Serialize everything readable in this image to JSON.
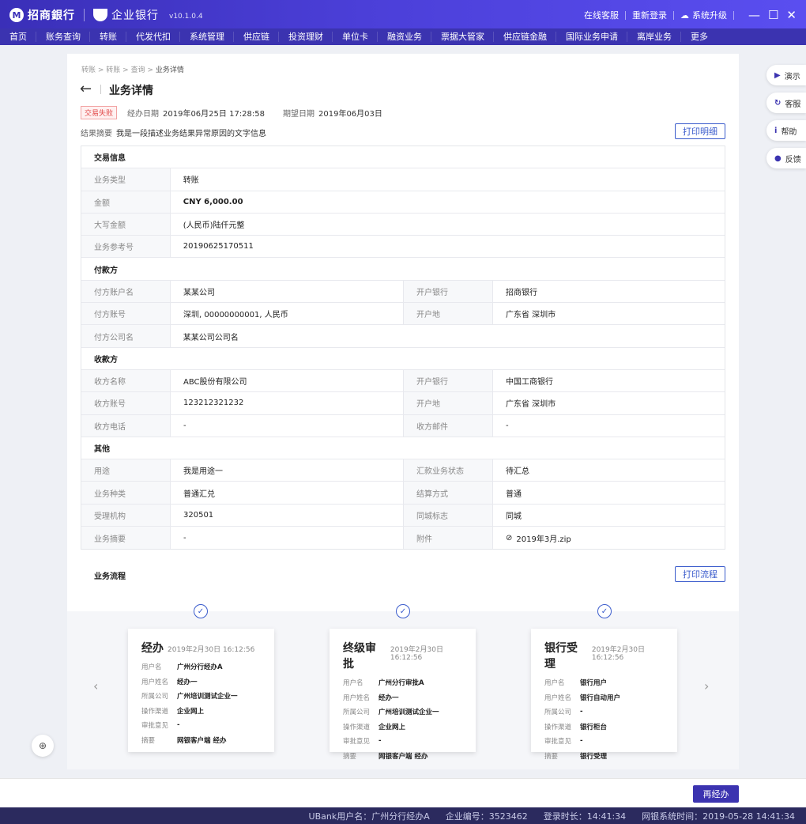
{
  "topbar": {
    "bank_name": "招商銀行",
    "ent_name": "企业银行",
    "version": "v10.1.0.4",
    "online_service": "在线客服",
    "relogin": "重新登录",
    "upgrade": "系统升级"
  },
  "nav": [
    "首页",
    "账务查询",
    "转账",
    "代发代扣",
    "系统管理",
    "供应链",
    "投资理财",
    "单位卡",
    "融资业务",
    "票据大管家",
    "供应链金融",
    "国际业务申请",
    "离岸业务",
    "更多"
  ],
  "breadcrumb": [
    "转账",
    "转账",
    "查询",
    "业务详情"
  ],
  "page_title": "业务详情",
  "status_badge": "交易失败",
  "meta": {
    "handle_label": "经办日期",
    "handle_value": "2019年06月25日 17:28:58",
    "expect_label": "期望日期",
    "expect_value": "2019年06月03日"
  },
  "summary": {
    "label": "结果摘要",
    "value": "我是一段描述业务结果异常原因的文字信息"
  },
  "print_detail": "打印明细",
  "print_flow": "打印流程",
  "sections": {
    "trade": {
      "title": "交易信息",
      "type_label": "业务类型",
      "type_value": "转账",
      "amount_label": "金额",
      "amount_value": "CNY 6,000.00",
      "upper_label": "大写金额",
      "upper_value": "(人民币)陆仟元整",
      "ref_label": "业务参考号",
      "ref_value": "20190625170511"
    },
    "payer": {
      "title": "付款方",
      "name_label": "付方账户名",
      "name_value": "某某公司",
      "bank_label": "开户银行",
      "bank_value": "招商银行",
      "acct_label": "付方账号",
      "acct_value": "深圳, 00000000001, 人民币",
      "loc_label": "开户地",
      "loc_value": "广东省 深圳市",
      "company_label": "付方公司名",
      "company_value": "某某公司公司名"
    },
    "payee": {
      "title": "收款方",
      "name_label": "收方名称",
      "name_value": "ABC股份有限公司",
      "bank_label": "开户银行",
      "bank_value": "中国工商银行",
      "acct_label": "收方账号",
      "acct_value": "123212321232",
      "loc_label": "开户地",
      "loc_value": "广东省 深圳市",
      "phone_label": "收方电话",
      "phone_value": "-",
      "mail_label": "收方邮件",
      "mail_value": "-"
    },
    "other": {
      "title": "其他",
      "use_label": "用途",
      "use_value": "我是用途一",
      "state_label": "汇款业务状态",
      "state_value": "待汇总",
      "kind_label": "业务种类",
      "kind_value": "普通汇兑",
      "settle_label": "结算方式",
      "settle_value": "普通",
      "org_label": "受理机构",
      "org_value": "320501",
      "city_label": "同城标志",
      "city_value": "同城",
      "abstract_label": "业务摘要",
      "abstract_value": "-",
      "attach_label": "附件",
      "attach_value": "2019年3月.zip"
    }
  },
  "flow_title": "业务流程",
  "flow_labels": {
    "user": "用户名",
    "username": "用户姓名",
    "company": "所属公司",
    "channel": "操作渠道",
    "opinion": "审批意见",
    "abstract": "摘要"
  },
  "flow_steps": [
    {
      "name": "经办",
      "time": "2019年2月30日 16:12:56",
      "user": "广州分行经办A",
      "username": "经办一",
      "company": "广州培训测试企业一",
      "channel": "企业网上",
      "opinion": "-",
      "abstract": "网银客户端 经办"
    },
    {
      "name": "终级审批",
      "time": "2019年2月30日 16:12:56",
      "user": "广州分行审批A",
      "username": "经办一",
      "company": "广州培训测试企业一",
      "channel": "企业网上",
      "opinion": "-",
      "abstract": "网银客户端 经办"
    },
    {
      "name": "银行受理",
      "time": "2019年2月30日 16:12:56",
      "user": "银行用户",
      "username": "银行自动用户",
      "company": "-",
      "channel": "银行柜台",
      "opinion": "-",
      "abstract": "银行受理"
    }
  ],
  "rail": [
    "演示",
    "客服",
    "帮助",
    "反馈"
  ],
  "reprocess": "再经办",
  "statusbar": {
    "user": "UBank用户名：广州分行经办A",
    "corp": "企业编号：3523462",
    "login": "登录时长：14:41:34",
    "time": "网银系统时间：2019-05-28 14:41:34"
  }
}
